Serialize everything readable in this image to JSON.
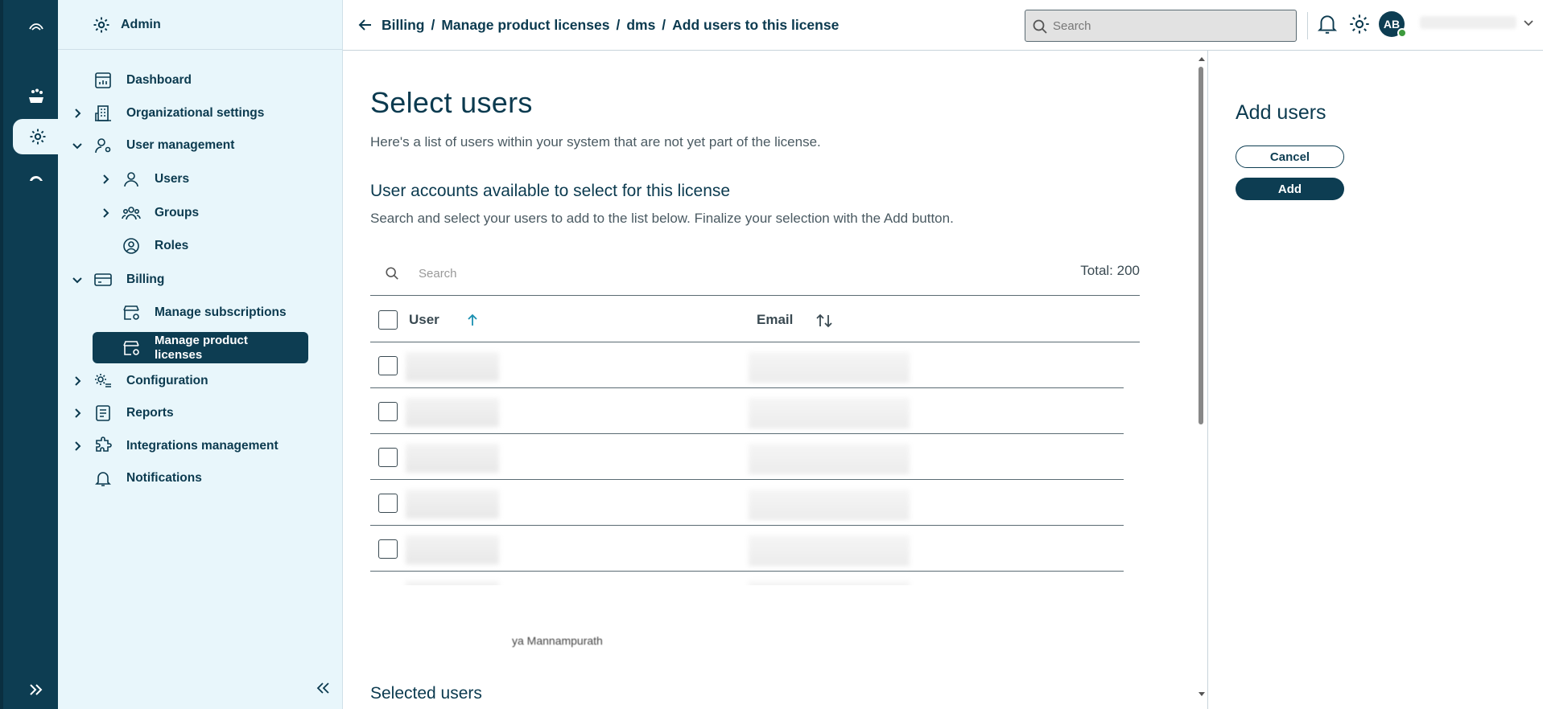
{
  "header": {
    "breadcrumb": [
      "Billing",
      "Manage product licenses",
      "dms",
      "Add users to this license"
    ],
    "search_placeholder": "Search",
    "avatar_initials": "AB"
  },
  "sidebar": {
    "title": "Admin",
    "items": [
      {
        "label": "Dashboard"
      },
      {
        "label": "Organizational settings"
      },
      {
        "label": "User management"
      },
      {
        "label": "Users"
      },
      {
        "label": "Groups"
      },
      {
        "label": "Roles"
      },
      {
        "label": "Billing"
      },
      {
        "label": "Manage subscriptions"
      },
      {
        "label": "Manage product licenses"
      },
      {
        "label": "Configuration"
      },
      {
        "label": "Reports"
      },
      {
        "label": "Integrations management"
      },
      {
        "label": "Notifications"
      }
    ]
  },
  "main": {
    "title": "Select users",
    "subtitle": "Here's a list of users within your system that are not yet part of the license.",
    "section_title": "User accounts available to select for this license",
    "section_desc": "Search and select your users to add to the list below. Finalize your selection with the Add button.",
    "table_search_placeholder": "Search",
    "total": "Total: 200",
    "columns": {
      "user": "User",
      "email": "Email"
    },
    "partial_row_text": "ya Mannampurath",
    "selected_title": "Selected users"
  },
  "panel": {
    "title": "Add users",
    "cancel": "Cancel",
    "add": "Add"
  },
  "colors": {
    "brand": "#0d3d52",
    "sidebar_bg": "#e8f6fb",
    "sort_accent": "#1a8fb0",
    "status_online": "#3d9a3d"
  }
}
